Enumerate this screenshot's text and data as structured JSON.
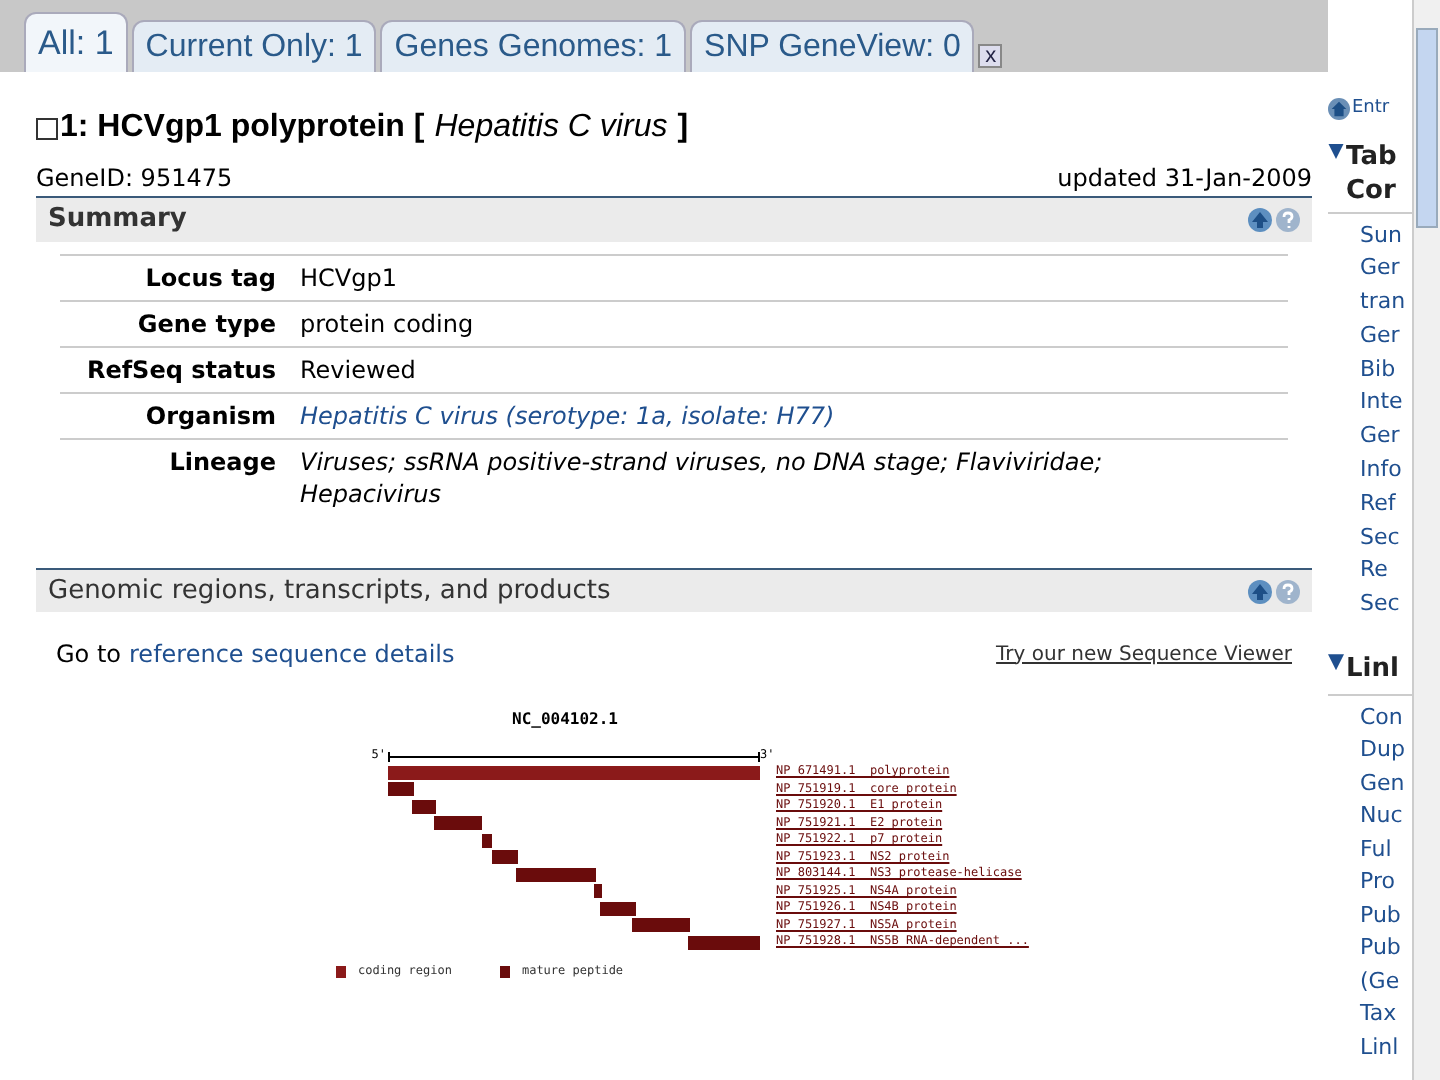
{
  "tabs": [
    {
      "label": "All: 1",
      "selected": true
    },
    {
      "label": "Current Only: 1",
      "selected": false
    },
    {
      "label": "Genes Genomes: 1",
      "selected": false
    },
    {
      "label": "SNP GeneView: 0",
      "selected": false
    }
  ],
  "close": "x",
  "record": {
    "checked": false,
    "title": "1: HCVgp1 polyprotein [",
    "organism": "Hepatitis C virus",
    "title_end": "]",
    "gene_id": "GeneID: 951475",
    "updated": "updated 31-Jan-2009"
  },
  "summary": {
    "title": "Summary",
    "rows": [
      {
        "label": "Locus tag",
        "value": "HCVgp1",
        "kind": "text"
      },
      {
        "label": "Gene type",
        "value": "protein coding",
        "kind": "text"
      },
      {
        "label": "RefSeq status",
        "value": "Reviewed",
        "kind": "text"
      },
      {
        "label": "Organism",
        "value": "Hepatitis C virus (serotype: 1a, isolate: H77)",
        "kind": "link"
      },
      {
        "label": "Lineage",
        "value": "Viruses; ssRNA positive-strand viruses, no DNA stage; Flaviviridae; Hepacivirus",
        "kind": "italic"
      }
    ]
  },
  "genomic": {
    "title": "Genomic regions, transcripts, and products",
    "goto": "Go to",
    "goto_link": "reference sequence details",
    "viewer_link": "Try our new Sequence Viewer",
    "diagram": {
      "sequence": "NC_004102.1",
      "five": "5'",
      "three": "3'",
      "products": [
        {
          "label": "NP_671491.1  polyprotein",
          "kind": "coding"
        },
        {
          "label": "NP_751919.1  core protein",
          "kind": "mature"
        },
        {
          "label": "NP_751920.1  E1 protein",
          "kind": "mature"
        },
        {
          "label": "NP_751921.1  E2 protein",
          "kind": "mature"
        },
        {
          "label": "NP_751922.1  p7 protein",
          "kind": "mature"
        },
        {
          "label": "NP_751923.1  NS2 protein",
          "kind": "mature"
        },
        {
          "label": "NP_803144.1  NS3 protease-helicase",
          "kind": "mature"
        },
        {
          "label": "NP_751925.1  NS4A protein",
          "kind": "mature"
        },
        {
          "label": "NP_751926.1  NS4B protein",
          "kind": "mature"
        },
        {
          "label": "NP_751927.1  NS5A protein",
          "kind": "mature"
        },
        {
          "label": "NP_751928.1  NS5B RNA-dependent ..."
        }
      ],
      "legend": [
        {
          "label": "coding region",
          "kind": "coding"
        },
        {
          "label": "mature peptide",
          "kind": "mature"
        }
      ]
    }
  },
  "sidebar": {
    "entrez": "Entr",
    "toc_title": [
      "Tab",
      "Cor"
    ],
    "toc": [
      "Sun",
      "Ger",
      "tran",
      "Ger",
      "Bib",
      "Inte",
      "Ger",
      "Info",
      "Ref",
      "Sec",
      "Re",
      "Sec"
    ],
    "links_title": "Linl",
    "links": [
      "Con",
      "Dup",
      "Gen",
      "Nuc",
      "Ful",
      "Pro",
      "Pub",
      "Pub",
      "(Ge",
      "Tax",
      "Linl"
    ]
  }
}
